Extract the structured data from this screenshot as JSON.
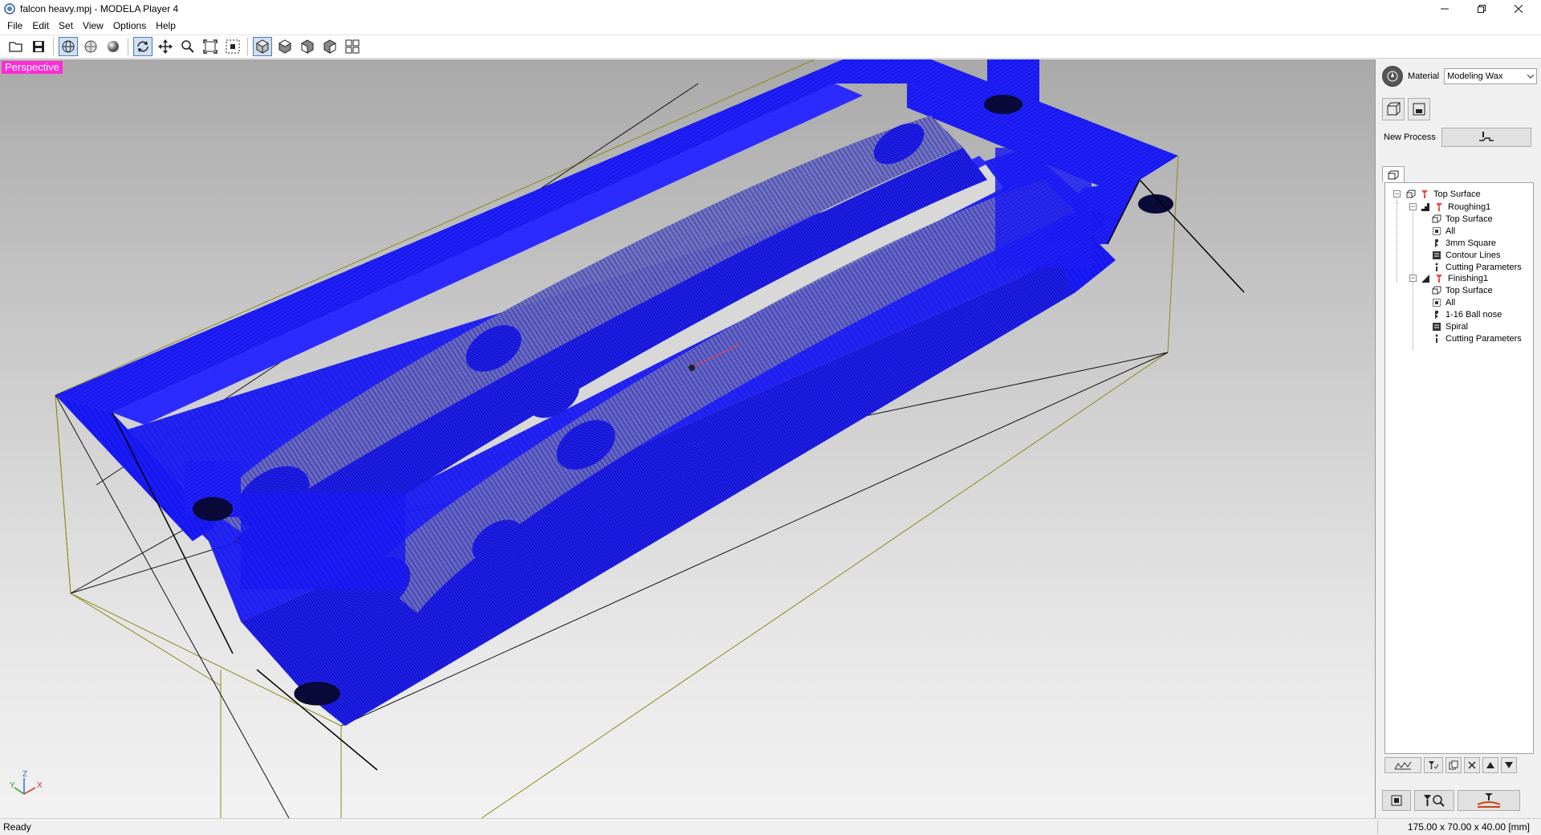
{
  "window": {
    "title": "falcon heavy.mpj - MODELA Player 4",
    "controls": [
      "minimize",
      "restore",
      "close"
    ]
  },
  "menu": [
    "File",
    "Edit",
    "Set",
    "View",
    "Options",
    "Help"
  ],
  "toolbar": {
    "groups": [
      [
        "open-icon",
        "save-icon"
      ],
      [
        "wireframe-view-icon",
        "surface-view-icon",
        "shaded-view-icon"
      ],
      [
        "rotate-icon",
        "pan-icon",
        "zoom-icon",
        "fit-view-icon",
        "zoom-window-icon"
      ],
      [
        "iso-view-icon",
        "top-view-icon",
        "front-view-icon",
        "right-view-icon",
        "multi-view-icon"
      ]
    ],
    "active": [
      "wireframe-view-icon",
      "rotate-icon",
      "iso-view-icon"
    ]
  },
  "viewport": {
    "label": "Perspective",
    "label_color": "#ff2bd6",
    "toolpath_color": "#1414ff",
    "axes": {
      "z": "Z",
      "y": "Y",
      "x": "X"
    }
  },
  "panel": {
    "material_label": "Material",
    "material_value": "Modeling Wax",
    "new_process_label": "New Process"
  },
  "tree": [
    {
      "label": "Top Surface",
      "depth": 0,
      "icon": "model-icon"
    },
    {
      "label": "Roughing1",
      "depth": 1,
      "icon": "roughing-icon"
    },
    {
      "label": "Top Surface",
      "depth": 2,
      "icon": "surface-icon"
    },
    {
      "label": "All",
      "depth": 2,
      "icon": "area-icon"
    },
    {
      "label": "3mm Square",
      "depth": 2,
      "icon": "tool-icon"
    },
    {
      "label": "Contour Lines",
      "depth": 2,
      "icon": "path-type-icon"
    },
    {
      "label": "Cutting Parameters",
      "depth": 2,
      "icon": "parameters-icon"
    },
    {
      "label": "Finishing1",
      "depth": 1,
      "icon": "finishing-icon"
    },
    {
      "label": "Top Surface",
      "depth": 2,
      "icon": "surface-icon"
    },
    {
      "label": "All",
      "depth": 2,
      "icon": "area-icon"
    },
    {
      "label": "1-16 Ball nose",
      "depth": 2,
      "icon": "tool-icon"
    },
    {
      "label": "Spiral",
      "depth": 2,
      "icon": "path-type-icon"
    },
    {
      "label": "Cutting Parameters",
      "depth": 2,
      "icon": "parameters-icon"
    }
  ],
  "status": {
    "text": "Ready",
    "dimensions": "175.00 x 70.00 x 40.00 [mm]"
  }
}
